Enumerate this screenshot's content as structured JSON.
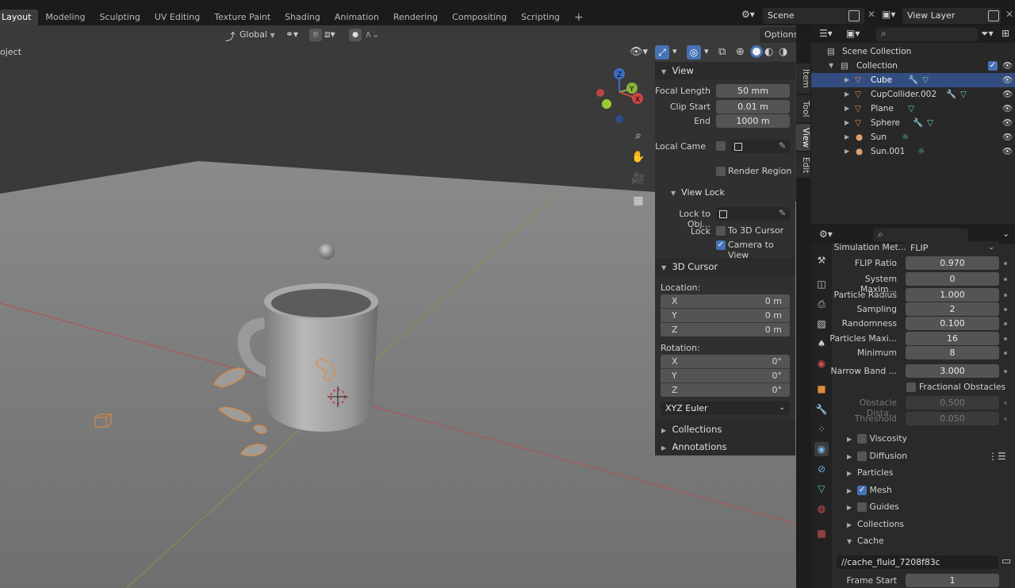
{
  "workspace_tabs": [
    "Layout",
    "Modeling",
    "Sculpting",
    "UV Editing",
    "Texture Paint",
    "Shading",
    "Animation",
    "Rendering",
    "Compositing",
    "Scripting"
  ],
  "scene": {
    "label": "Scene"
  },
  "view_layer": {
    "label": "View Layer"
  },
  "viewport_header": {
    "transform_orientation": "Global",
    "options_label": "Options",
    "object_label": "oject"
  },
  "npanel": {
    "tabs": [
      "Item",
      "Tool",
      "View",
      "Edit"
    ],
    "view": {
      "header": "View",
      "focal_length_label": "Focal Length",
      "focal_length": "50 mm",
      "clip_start_label": "Clip Start",
      "clip_start": "0.01 m",
      "end_label": "End",
      "end": "1000 m",
      "local_camera_label": "Local Came",
      "render_region_label": "Render Region"
    },
    "view_lock": {
      "header": "View Lock",
      "lock_to_obj_label": "Lock to Obj...",
      "lock_label": "Lock",
      "to_3d_cursor_label": "To 3D Cursor",
      "camera_to_view_label": "Camera to View"
    },
    "cursor": {
      "header": "3D Cursor",
      "location_label": "Location:",
      "location": [
        {
          "axis": "X",
          "value": "0 m"
        },
        {
          "axis": "Y",
          "value": "0 m"
        },
        {
          "axis": "Z",
          "value": "0 m"
        }
      ],
      "rotation_label": "Rotation:",
      "rotation": [
        {
          "axis": "X",
          "value": "0°"
        },
        {
          "axis": "Y",
          "value": "0°"
        },
        {
          "axis": "Z",
          "value": "0°"
        }
      ],
      "rotation_mode": "XYZ Euler"
    },
    "collections_label": "Collections",
    "annotations_label": "Annotations"
  },
  "outliner": {
    "scene_collection": "Scene Collection",
    "collection": "Collection",
    "items": [
      "Cube",
      "CupCollider.002",
      "Plane",
      "Sphere",
      "Sun",
      "Sun.001"
    ]
  },
  "properties": {
    "simulation_method_label": "Simulation Met...",
    "simulation_method": "FLIP",
    "flip_ratio_label": "FLIP Ratio",
    "flip_ratio": "0.970",
    "system_max_label": "System Maxim...",
    "system_max": "0",
    "particle_radius_label": "Particle Radius",
    "particle_radius": "1.000",
    "sampling_label": "Sampling",
    "sampling": "2",
    "randomness_label": "Randomness",
    "randomness": "0.100",
    "particles_max_label": "Particles Maxi...",
    "particles_max": "16",
    "minimum_label": "Minimum",
    "minimum": "8",
    "narrow_band_label": "Narrow Band ...",
    "narrow_band": "3.000",
    "fractional_obstacles_label": "Fractional Obstacles",
    "obstacle_distance_label": "Obstacle Dista...",
    "obstacle_distance": "0.500",
    "threshold_label": "Threshold",
    "threshold": "0.050",
    "panels": [
      "Viscosity",
      "Diffusion",
      "Particles",
      "Mesh",
      "Guides",
      "Collections",
      "Cache"
    ],
    "cache_directory": "//cache_fluid_7208f83c",
    "frame_start_label": "Frame Start",
    "frame_start": "1"
  },
  "colors": {
    "accent": "#4772b3",
    "selection": "#334d80",
    "object_orange": "#e08a3c",
    "viewport_floor": "#8c8c8c"
  }
}
